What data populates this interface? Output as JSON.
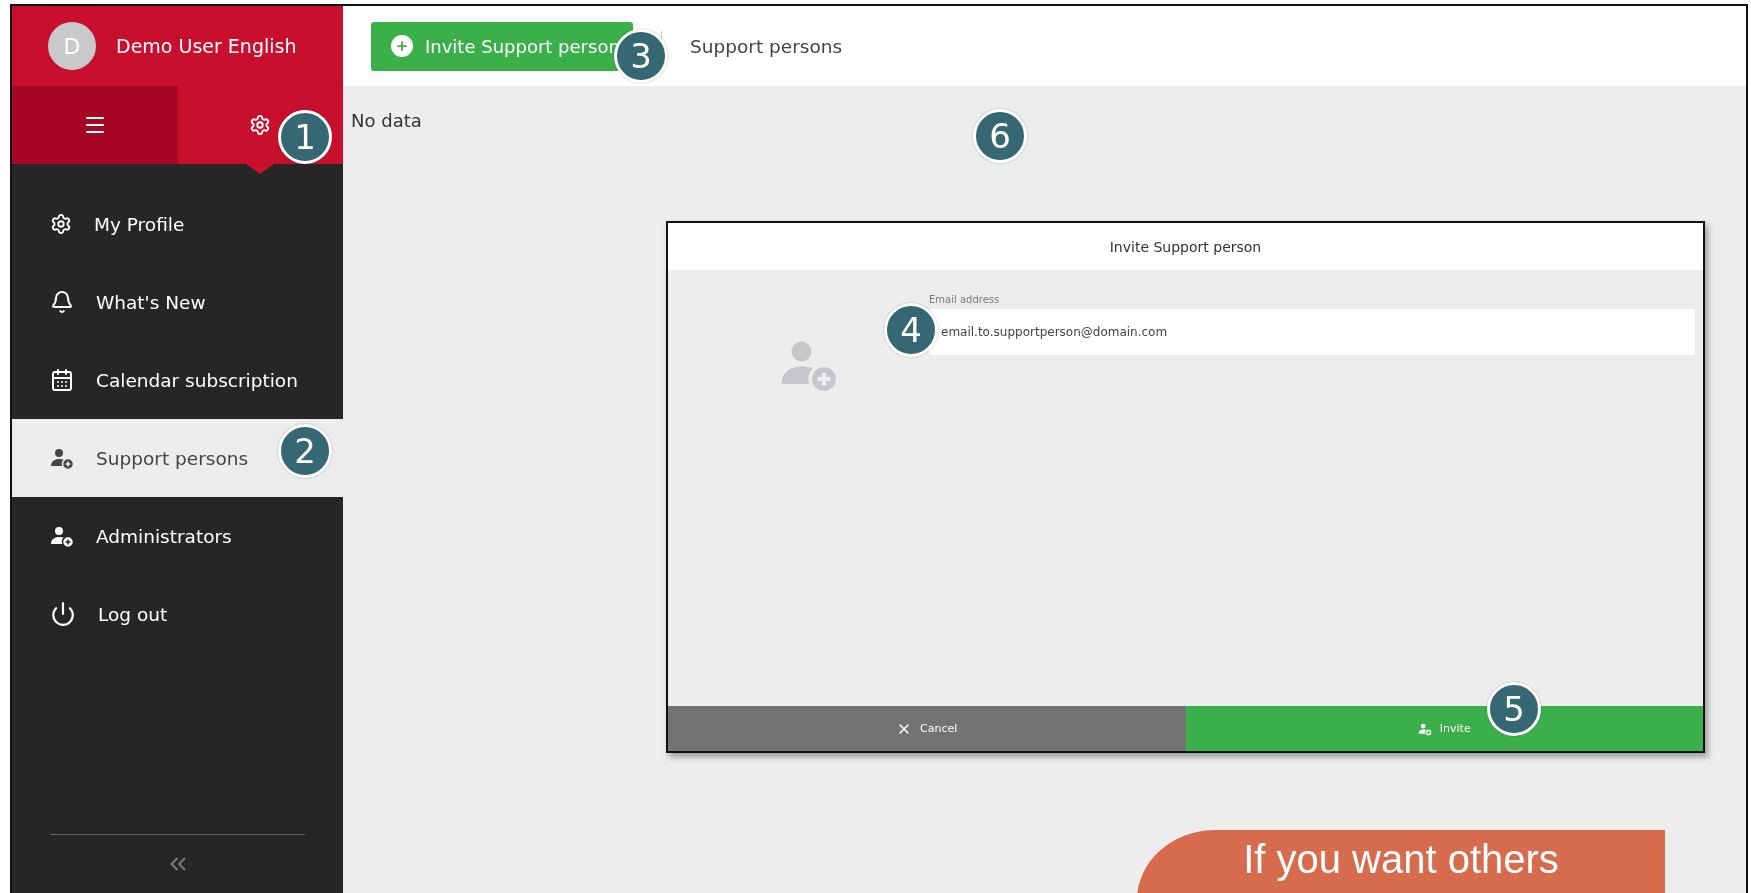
{
  "user": {
    "initial": "D",
    "name": "Demo User English"
  },
  "sidebar_tabs": [
    {
      "kind": "menu",
      "selected": false
    },
    {
      "kind": "settings",
      "selected": true
    }
  ],
  "sidebar": {
    "items": [
      {
        "kind": "gear",
        "label": "My Profile",
        "selected": false
      },
      {
        "kind": "bell",
        "label": "What's New",
        "selected": false
      },
      {
        "kind": "calendar",
        "label": "Calendar subscription",
        "selected": false
      },
      {
        "kind": "person",
        "label": "Support persons",
        "selected": true
      },
      {
        "kind": "person",
        "label": "Administrators",
        "selected": false
      },
      {
        "kind": "power",
        "label": "Log out",
        "selected": false
      }
    ]
  },
  "toolbar": {
    "invite_button": "Invite Support person",
    "title": "Support persons"
  },
  "content": {
    "empty_text": "No data"
  },
  "dialog": {
    "title": "Invite Support person",
    "email_label": "Email address",
    "email_value": "email.to.supportperson@domain.com",
    "cancel_button": "Cancel",
    "invite_button": "Invite"
  },
  "annotations": [
    "1",
    "2",
    "3",
    "4",
    "5",
    "6"
  ],
  "callout": {
    "text": "If you want others"
  }
}
